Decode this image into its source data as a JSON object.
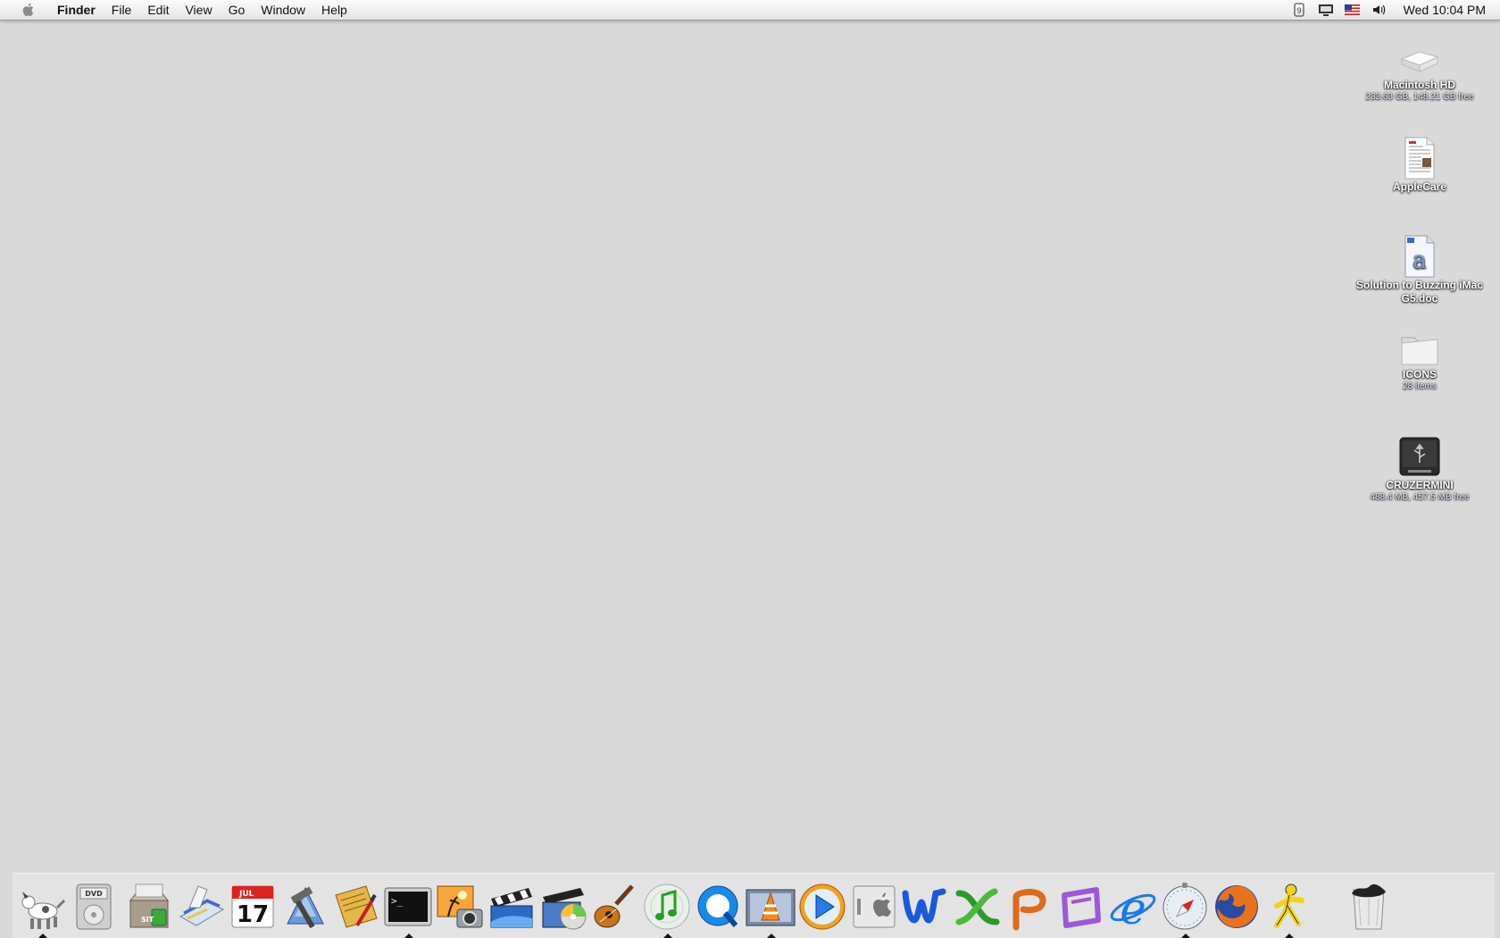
{
  "menubar": {
    "app_name": "Finder",
    "menus": [
      "File",
      "Edit",
      "View",
      "Go",
      "Window",
      "Help"
    ],
    "clock": "Wed 10:04 PM"
  },
  "desktop": {
    "items": [
      {
        "name": "Macintosh HD",
        "info": "233.63 GB, 148.21 GB free",
        "icon": "hard-drive-icon"
      },
      {
        "name": "AppleCare",
        "info": "",
        "icon": "document-icon"
      },
      {
        "name": "Solution to Buzzing iMac G5.doc",
        "info": "",
        "icon": "word-document-icon"
      },
      {
        "name": "ICONS",
        "info": "28 items",
        "icon": "folder-icon"
      },
      {
        "name": "CRUZERMINI",
        "info": "488.4 MB, 457.5 MB free",
        "icon": "usb-drive-icon"
      }
    ]
  },
  "dock": {
    "apps": [
      {
        "icon": "dog-app-icon",
        "running": true
      },
      {
        "icon": "dvd-player-icon",
        "running": false
      },
      {
        "icon": "stuffit-icon",
        "running": false
      },
      {
        "icon": "scanner-icon",
        "running": false
      },
      {
        "icon": "ical-icon",
        "running": false
      },
      {
        "icon": "xcode-icon",
        "running": false
      },
      {
        "icon": "script-editor-icon",
        "running": false
      },
      {
        "icon": "terminal-icon",
        "running": true
      },
      {
        "icon": "iphoto-icon",
        "running": false
      },
      {
        "icon": "imovie-icon",
        "running": false
      },
      {
        "icon": "idvd-icon",
        "running": false
      },
      {
        "icon": "garageband-icon",
        "running": false
      },
      {
        "icon": "itunes-icon",
        "running": true
      },
      {
        "icon": "quicktime-icon",
        "running": false
      },
      {
        "icon": "vlc-icon",
        "running": true
      },
      {
        "icon": "media-player-icon",
        "running": false
      },
      {
        "icon": "system-preferences-icon",
        "running": false
      },
      {
        "icon": "word-icon",
        "running": false
      },
      {
        "icon": "excel-icon",
        "running": false
      },
      {
        "icon": "powerpoint-icon",
        "running": false
      },
      {
        "icon": "entourage-icon",
        "running": false
      },
      {
        "icon": "internet-explorer-icon",
        "running": false
      },
      {
        "icon": "safari-icon",
        "running": true
      },
      {
        "icon": "firefox-icon",
        "running": false
      },
      {
        "icon": "aim-icon",
        "running": true
      },
      {
        "icon": "trash-icon",
        "running": false
      }
    ],
    "labels": {
      "ical_month": "JUL",
      "ical_day": "17",
      "dvd_label": "DVD",
      "stuffit_label": "SIT",
      "terminal_prompt": ">_"
    }
  }
}
